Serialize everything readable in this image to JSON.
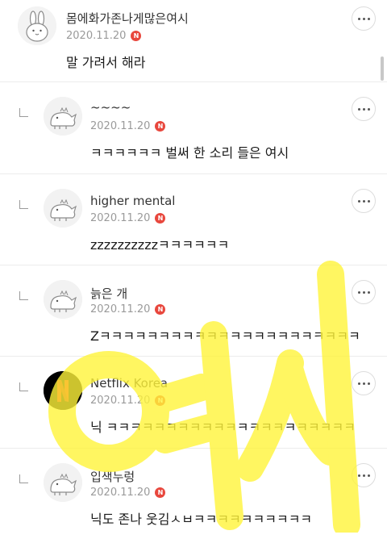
{
  "scrollbar_visible": true,
  "watermark": {
    "text": "여시",
    "color": "#fff43a"
  },
  "badge_letter": "N",
  "comments": [
    {
      "nickname": "몸에화가존나게많은여시",
      "date": "2020.11.20",
      "text": "말 가려서 해라",
      "avatar": "bunny-avatar"
    },
    {
      "nickname": "~~~~",
      "date": "2020.11.20",
      "text": "ㅋㅋㅋㅋㅋㅋ 벌써 한 소리 들은 여시",
      "avatar": "dino-avatar"
    },
    {
      "nickname": "higher mental",
      "date": "2020.11.20",
      "text": "zzzzzzzzzzㅋㅋㅋㅋㅋㅋ",
      "avatar": "dino-avatar"
    },
    {
      "nickname": "늙은 개",
      "date": "2020.11.20",
      "text": "Zㅋㅋㅋㅋㅋㅋㅋㅋㅋㅋㅋㅋㅋㅋㅋㅋㅋㅋㅋㅋㅋㅋ",
      "avatar": "dino-avatar"
    },
    {
      "nickname": "Netflix Korea",
      "date": "2020.11.20",
      "text": "닉 ㅋㅋㅋㅋㅋㅋㅋㅋㅋㅋㅋㅋㅋㅋㅋㅋㅋㅋㅋㅋㅋ",
      "avatar": "netflix-logo"
    },
    {
      "nickname": "입색누렁",
      "date": "2020.11.20",
      "text": "닉도 존나 웃김ㅅㅂㅋㅋㅋㅋㅋㅋㅋㅋㅋㅋ",
      "avatar": "dino-avatar"
    }
  ]
}
